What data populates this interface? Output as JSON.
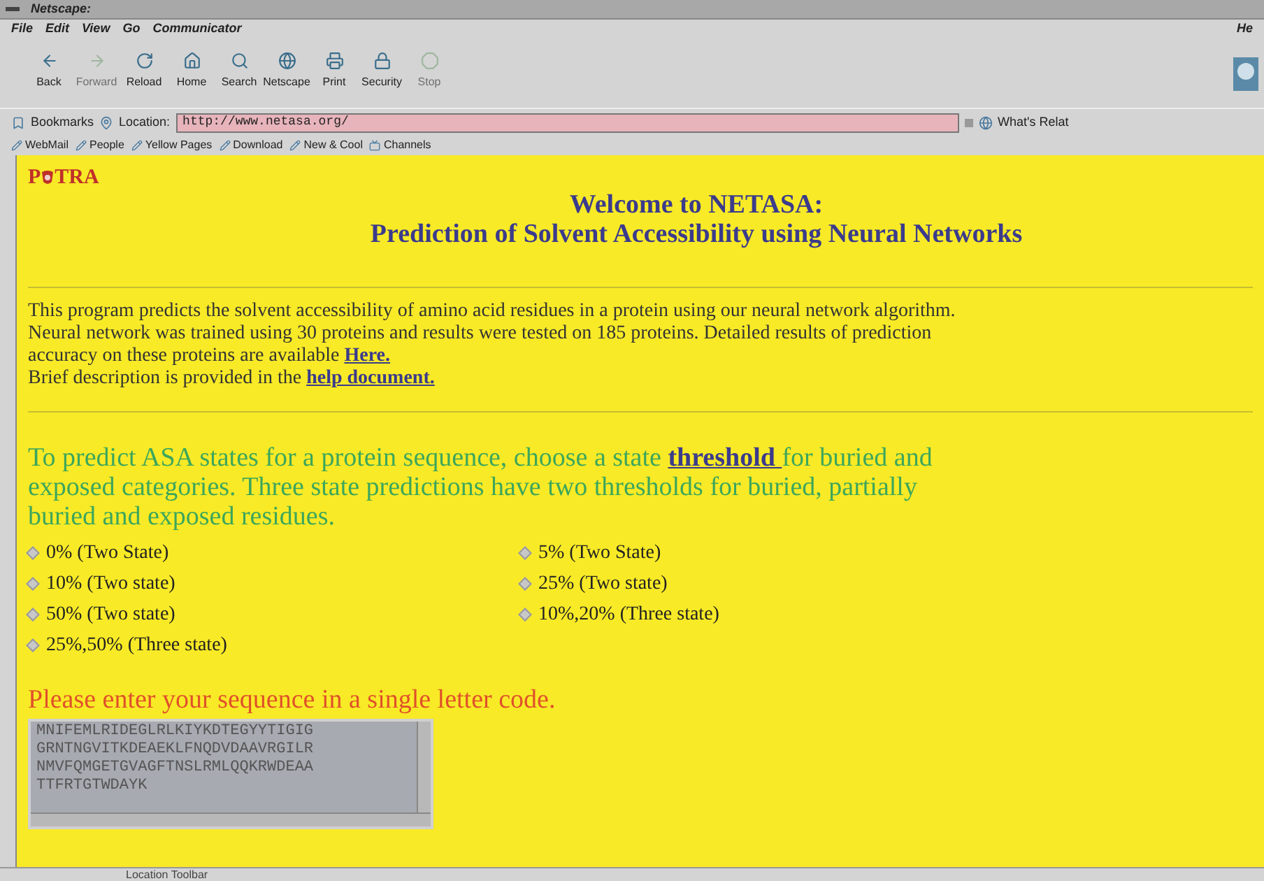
{
  "window": {
    "title": "Netscape:"
  },
  "menu": [
    "File",
    "Edit",
    "View",
    "Go",
    "Communicator",
    "He"
  ],
  "toolbar": [
    {
      "label": "Back",
      "kind": "back",
      "disabled": false
    },
    {
      "label": "Forward",
      "kind": "forward",
      "disabled": true
    },
    {
      "label": "Reload",
      "kind": "reload",
      "disabled": false
    },
    {
      "label": "Home",
      "kind": "home",
      "disabled": false
    },
    {
      "label": "Search",
      "kind": "search",
      "disabled": false
    },
    {
      "label": "Netscape",
      "kind": "netscape",
      "disabled": false
    },
    {
      "label": "Print",
      "kind": "print",
      "disabled": false
    },
    {
      "label": "Security",
      "kind": "security",
      "disabled": false
    },
    {
      "label": "Stop",
      "kind": "stop",
      "disabled": true
    }
  ],
  "location_bar": {
    "bookmarks": "Bookmarks",
    "location_label": "Location:",
    "url": "http://www.netasa.org/",
    "related": "What's Relat"
  },
  "personal_toolbar": [
    "WebMail",
    "People",
    "Yellow Pages",
    "Download",
    "New & Cool",
    "Channels"
  ],
  "page": {
    "logo": {
      "left": "P",
      "right": "TRA"
    },
    "heading": [
      "Welcome to NETASA:",
      "Prediction of Solvent Accessibility using Neural Networks"
    ],
    "intro": [
      [
        {
          "kind": "text",
          "text": "This program predicts the solvent accessibility of amino acid residues in a protein using our neural network algorithm."
        }
      ],
      [
        {
          "kind": "text",
          "text": "Neural network was trained using 30 proteins and results were tested on 185 proteins. Detailed results of prediction"
        }
      ],
      [
        {
          "kind": "text",
          "text": "accuracy on these proteins are available "
        },
        {
          "kind": "link",
          "text": "Here."
        }
      ],
      [
        {
          "kind": "text",
          "text": "Brief description is provided in the "
        },
        {
          "kind": "link",
          "text": "help document."
        }
      ]
    ],
    "instructions": [
      {
        "kind": "text",
        "text": "To predict ASA states for a protein sequence, choose a state "
      },
      {
        "kind": "link",
        "text": "threshold "
      },
      {
        "kind": "text",
        "text": "for buried and exposed categories. Three state predictions have two thresholds for buried, partially buried and exposed residues."
      }
    ],
    "thresholds": [
      {
        "label": "0% (Two State)",
        "selected": false
      },
      {
        "label": "5% (Two State)",
        "selected": false
      },
      {
        "label": "10% (Two state)",
        "selected": false
      },
      {
        "label": "25% (Two state)",
        "selected": false
      },
      {
        "label": "50% (Two state)",
        "selected": false
      },
      {
        "label": "10%,20% (Three state)",
        "selected": false
      },
      {
        "label": "25%,50% (Three state)",
        "selected": false
      }
    ],
    "sequence_prompt": "Please enter your sequence in a single letter code.",
    "sequence": "MNIFEMLRIDEGLRLKIYKDTEGYYTIGIG\nGRNTNGVITKDEAEKLFNQDVDAAVRGILR\nNMVFQMGETGVAGFTNSLRMLQQKRWDEAA\nTTFRTGTWDAYK"
  },
  "status_bar": "Location Toolbar"
}
